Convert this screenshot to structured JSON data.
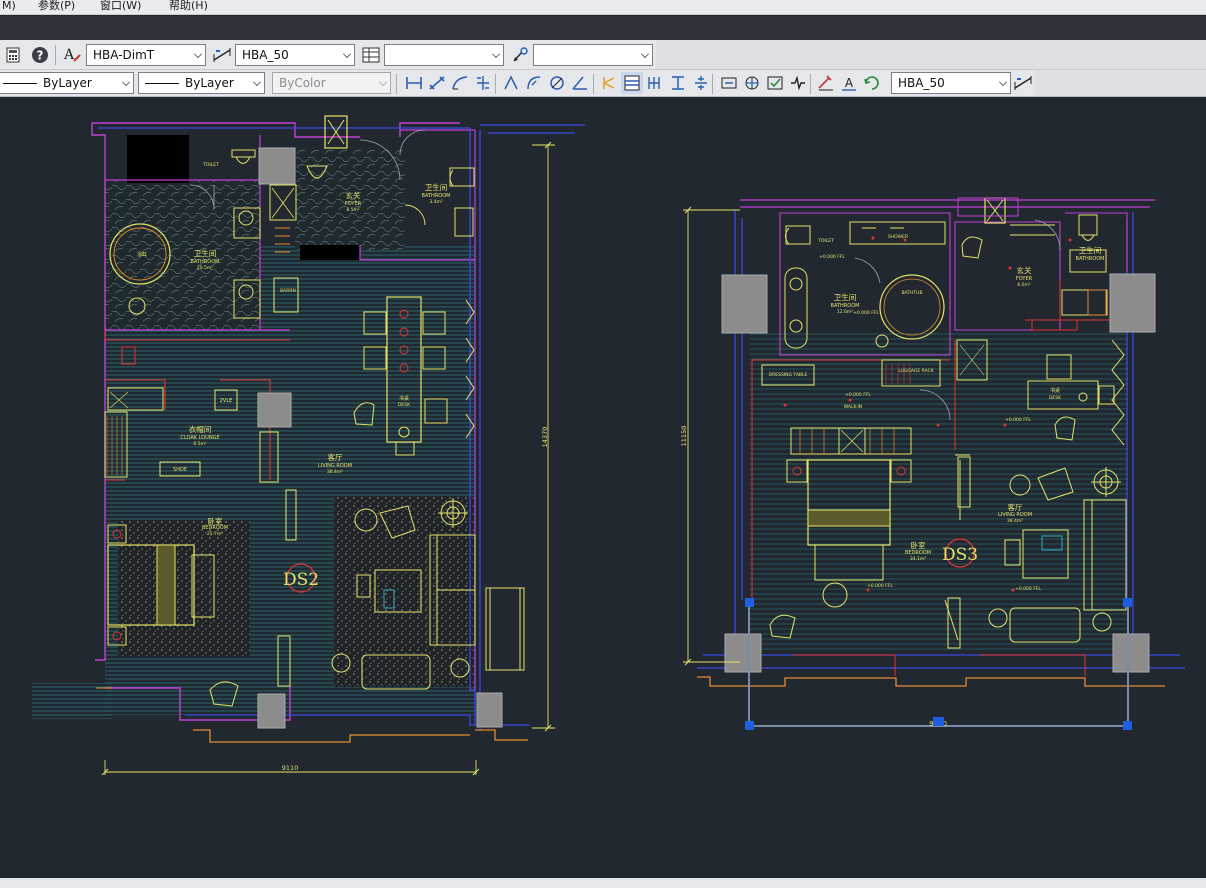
{
  "menubar": {
    "items": [
      "M)",
      "参数(P)",
      "窗口(W)",
      "帮助(H)"
    ]
  },
  "toolbar1": {
    "text_style": "HBA-DimT",
    "dim_style": "HBA_50",
    "table_style": "",
    "multileader_style": ""
  },
  "toolbar2": {
    "linetype": "ByLayer",
    "lineweight": "ByLayer",
    "plot_style": "ByColor",
    "dim_style": "HBA_50"
  },
  "drawing": {
    "plan_left": {
      "tag": "DS2",
      "dim_width": "9110",
      "dim_height": "14370",
      "rooms": [
        {
          "cn": "卫生间",
          "en": "BATHROOM",
          "area": "20.5m²"
        },
        {
          "cn": "玄关",
          "en": "FOYER",
          "area": "8.5m²"
        },
        {
          "cn": "卫生间",
          "en": "BATHROOM",
          "area": "3.4m²"
        },
        {
          "cn": "衣帽间",
          "en": "CLOAK LOUNGE",
          "area": "6.5m²"
        },
        {
          "cn": "客厅",
          "en": "LIVING ROOM",
          "area": "38.4m²"
        },
        {
          "cn": "卧室",
          "en": "BEDROOM",
          "area": "25.7m²"
        },
        {
          "cn": "书桌",
          "en": "DESK",
          "area": ""
        }
      ],
      "small_labels": [
        "TOILET",
        "浴缸",
        "2VLE",
        "SHOE",
        "BARRN"
      ]
    },
    "plan_right": {
      "tag": "DS3",
      "dim_width": "9000",
      "dim_height": "11150",
      "rooms": [
        {
          "cn": "卫生间",
          "en": "BATHROOM",
          "area": "12.0m²"
        },
        {
          "cn": "玄关",
          "en": "FOYER",
          "area": "6.0m²"
        },
        {
          "cn": "卫生间",
          "en": "BATHROOM",
          "area": ""
        },
        {
          "cn": "客厅",
          "en": "LIVING ROOM",
          "area": "38.4m²"
        },
        {
          "cn": "卧室",
          "en": "BEDROOM",
          "area": "34.1m²"
        },
        {
          "cn": "书桌",
          "en": "DESK",
          "area": ""
        }
      ],
      "small_labels": [
        "TOILET",
        "SHOWER",
        "DRESSING TABLE",
        "LUGGAGE RACK",
        "BATHTUB",
        "WALK-IN"
      ],
      "elevations": [
        "+0.000 FFL",
        "+0.000 FFL",
        "+0.000 FFL",
        "+0.000 FFL",
        "+0.000 FFL",
        "+0.000 FFL"
      ]
    }
  },
  "colors": {
    "background": "#212830",
    "wall_blue": "#3a49e0",
    "wall_magenta": "#c13fd6",
    "furniture_yellow": "#e4e36a",
    "grid_cyan": "#2f8a8a",
    "orange": "#e68a2e",
    "red": "#e03434",
    "column_gray": "#8c8c8c",
    "selection_blue": "#1e5fe0"
  },
  "icons": [
    "calculator-icon",
    "help-icon",
    "text-style-icon",
    "dim-style-icon",
    "table-style-icon",
    "multileader-icon",
    "linear-dim-icon",
    "aligned-dim-icon",
    "arc-length-icon",
    "ordinate-icon",
    "radius-icon",
    "jogged-icon",
    "diameter-icon",
    "angular-icon",
    "quick-dim-icon",
    "baseline-icon",
    "continue-icon",
    "space-icon",
    "break-icon",
    "tolerance-icon",
    "center-mark-icon",
    "inspect-icon",
    "jogged-linear-icon",
    "edit-dim-icon",
    "edit-text-icon",
    "update-icon",
    "dim-style-manager-icon"
  ]
}
